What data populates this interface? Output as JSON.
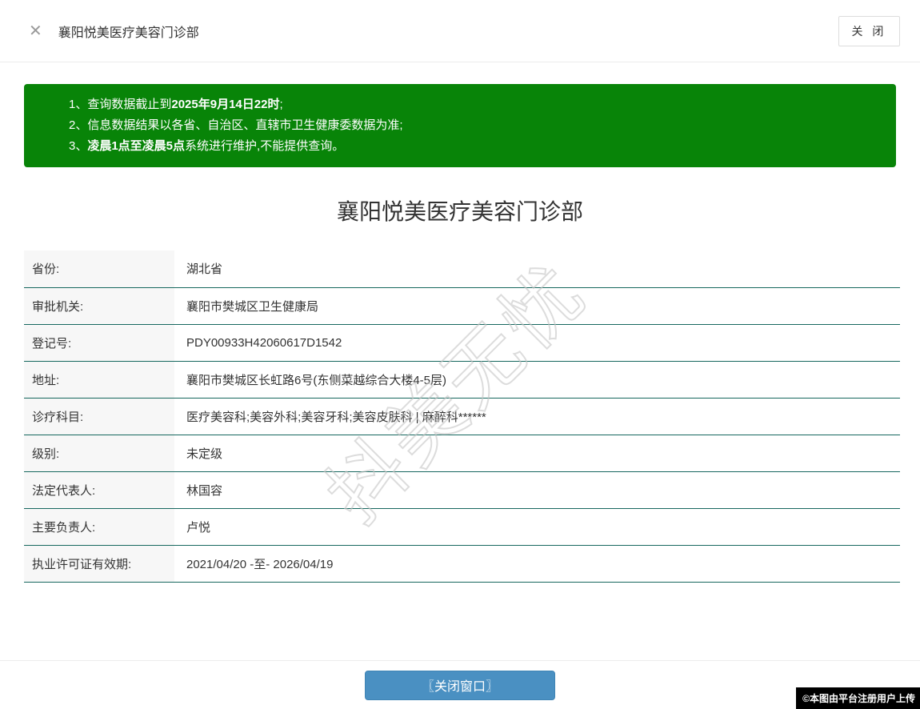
{
  "header": {
    "title": "襄阳悦美医疗美容门诊部",
    "close_icon": "✕",
    "close_button_label": "关 闭"
  },
  "notice": {
    "items": [
      {
        "num": "1、",
        "pre": "查询数据截止到",
        "bold": "2025年9月14日22时",
        "post": ";"
      },
      {
        "num": "2、",
        "pre": "信息数据结果以各省、自治区、直辖市卫生健康委数据为准;",
        "bold": "",
        "post": ""
      },
      {
        "num": "3、",
        "pre": "",
        "bold": "凌晨1点至凌晨5点",
        "post": "系统进行维护,不能提供查询。"
      }
    ]
  },
  "main": {
    "title": "襄阳悦美医疗美容门诊部",
    "rows": [
      {
        "label": "省份:",
        "value": "湖北省"
      },
      {
        "label": "审批机关:",
        "value": "襄阳市樊城区卫生健康局"
      },
      {
        "label": "登记号:",
        "value": "PDY00933H42060617D1542"
      },
      {
        "label": "地址:",
        "value": "襄阳市樊城区长虹路6号(东侧菜越综合大楼4-5层)"
      },
      {
        "label": "诊疗科目:",
        "value": "医疗美容科;美容外科;美容牙科;美容皮肤科 | 麻醉科******"
      },
      {
        "label": "级别:",
        "value": "未定级"
      },
      {
        "label": "法定代表人:",
        "value": "林国容"
      },
      {
        "label": "主要负责人:",
        "value": "卢悦"
      },
      {
        "label": "执业许可证有效期:",
        "value": "2021/04/20 -至- 2026/04/19"
      }
    ]
  },
  "footer": {
    "close_window_button": "〖关闭窗口〗"
  },
  "watermark_text": "抖美无忧",
  "copyright_label": "©本图由平台注册用户上传",
  "colors": {
    "notice_green": "#088408",
    "button_blue": "#4a90c2",
    "row_divider_teal": "#17685f"
  }
}
